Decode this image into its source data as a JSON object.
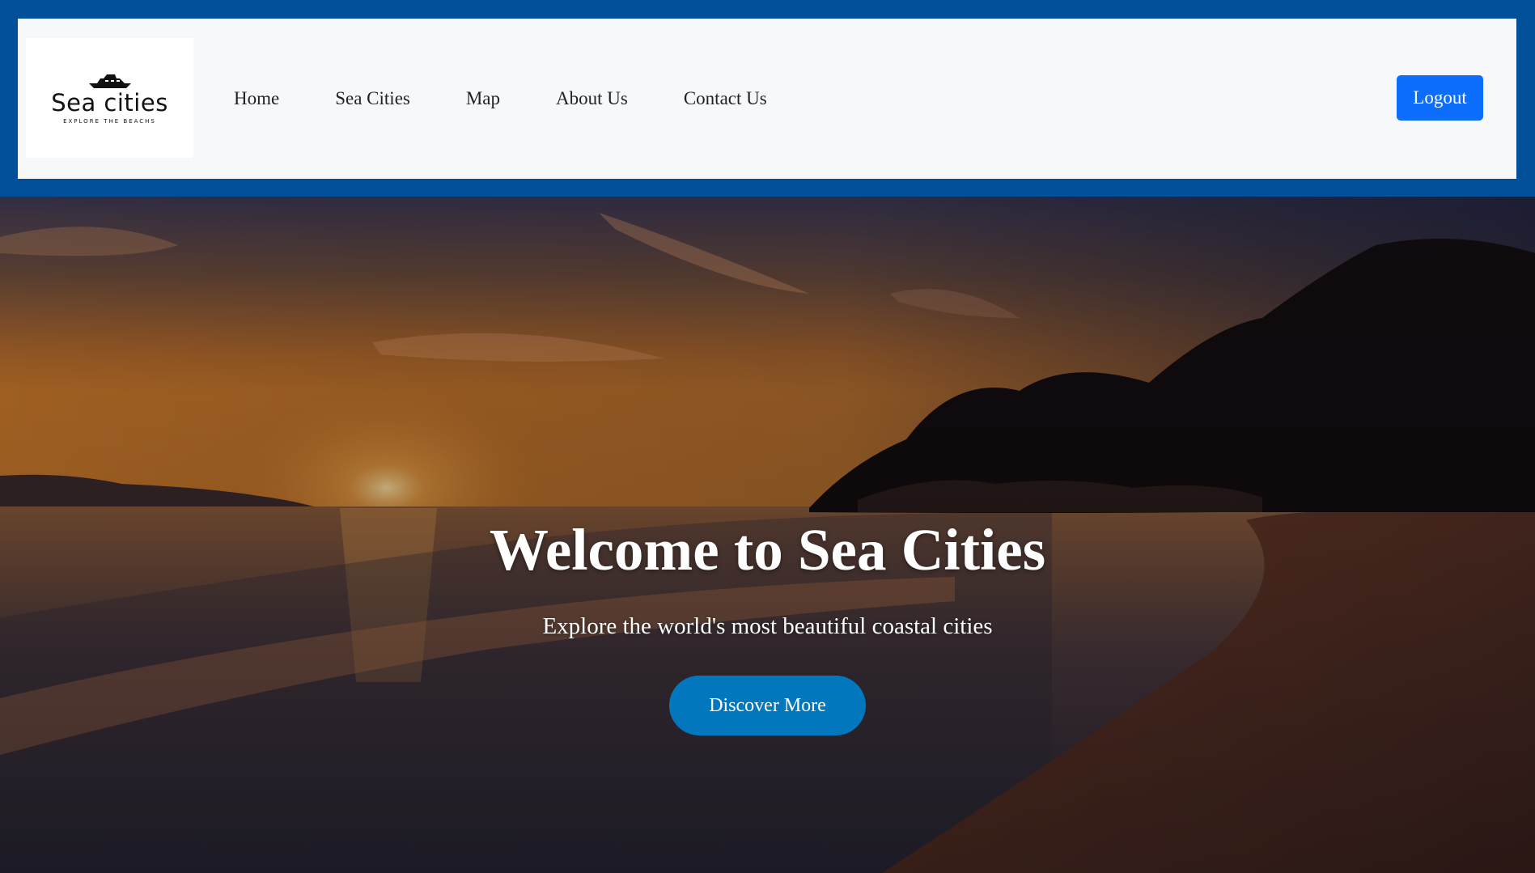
{
  "brand": {
    "name": "Sea cities",
    "tagline": "EXPLORE THE BEACHS",
    "logo_icon": "yacht-icon"
  },
  "nav": {
    "links": [
      "Home",
      "Sea Cities",
      "Map",
      "About Us",
      "Contact Us"
    ],
    "logout_label": "Logout"
  },
  "hero": {
    "title": "Welcome to Sea Cities",
    "subtitle": "Explore the world's most beautiful coastal cities",
    "cta_label": "Discover More"
  },
  "colors": {
    "frame": "#03509a",
    "navbar_bg": "#f7f8fa",
    "logout_button": "#0d6efd",
    "cta_button": "#0277bd"
  }
}
